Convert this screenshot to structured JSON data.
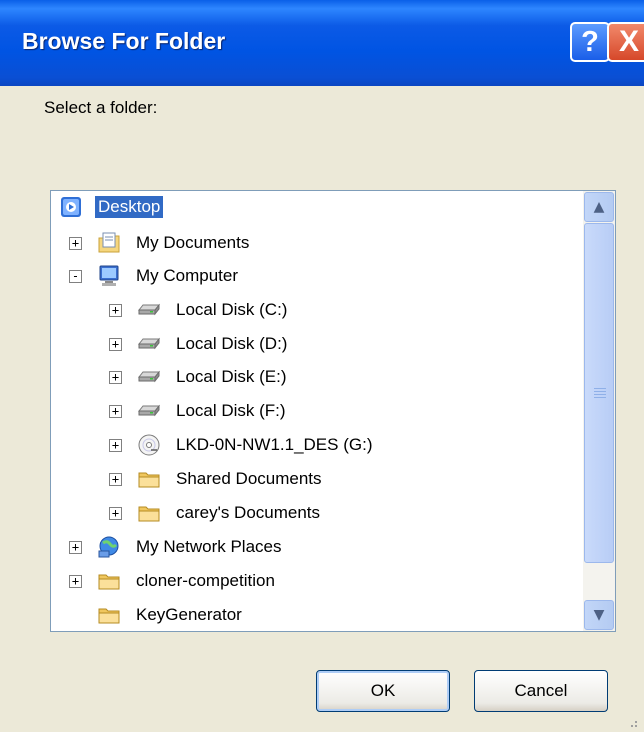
{
  "window": {
    "title": "Browse For Folder",
    "help_label": "?",
    "close_label": "X"
  },
  "prompt": "Select a folder:",
  "tree": {
    "items": [
      {
        "label": "Desktop",
        "icon": "desktop-icon",
        "selected": true
      },
      {
        "label": "My Documents",
        "icon": "documents-folder-icon",
        "expander": "+"
      },
      {
        "label": "My Computer",
        "icon": "computer-icon",
        "expander": "-"
      },
      {
        "label": "Local Disk (C:)",
        "icon": "hard-drive-icon",
        "expander": "+"
      },
      {
        "label": "Local Disk (D:)",
        "icon": "hard-drive-icon",
        "expander": "+"
      },
      {
        "label": "Local Disk (E:)",
        "icon": "hard-drive-icon",
        "expander": "+"
      },
      {
        "label": "Local Disk (F:)",
        "icon": "hard-drive-icon",
        "expander": "+"
      },
      {
        "label": "LKD-0N-NW1.1_DES (G:)",
        "icon": "cd-drive-icon",
        "expander": "+"
      },
      {
        "label": "Shared Documents",
        "icon": "folder-icon",
        "expander": "+"
      },
      {
        "label": "carey's Documents",
        "icon": "folder-icon",
        "expander": "+"
      },
      {
        "label": "My Network Places",
        "icon": "network-places-icon",
        "expander": "+"
      },
      {
        "label": "cloner-competition",
        "icon": "folder-icon",
        "expander": "+"
      },
      {
        "label": "KeyGenerator",
        "icon": "folder-icon"
      }
    ]
  },
  "buttons": {
    "ok": "OK",
    "cancel": "Cancel"
  },
  "colors": {
    "titlebar": "#0054e3",
    "selection": "#316ac5",
    "dialog_background": "#ece9d8"
  }
}
